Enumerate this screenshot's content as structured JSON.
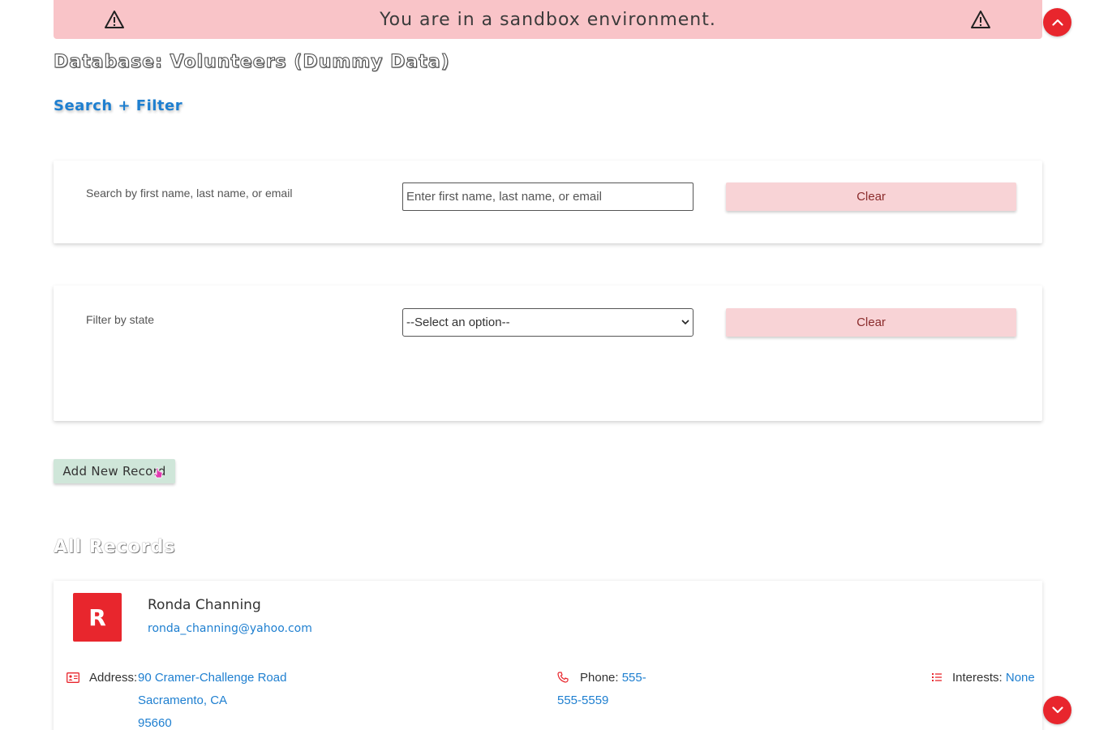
{
  "banner": {
    "text": "You are in a sandbox environment."
  },
  "header": {
    "title": "Database: Volunteers (Dummy Data)",
    "search_filter_link": "Search + Filter"
  },
  "search": {
    "label": "Search by first name, last name, or email",
    "placeholder": "Enter first name, last name, or email",
    "clear_label": "Clear"
  },
  "filter": {
    "label": "Filter by state",
    "selected": "--Select an option--",
    "clear_label": "Clear"
  },
  "actions": {
    "add_record": "Add New Record"
  },
  "records": {
    "title": "All Records",
    "items": [
      {
        "initial": "R",
        "name": "Ronda Channing",
        "email": "ronda_channing@yahoo.com",
        "address_label": "Address:",
        "address_line1": "90 Cramer-Challenge Road",
        "address_line2": "Sacramento, CA",
        "address_line3": "95660",
        "phone_label": "Phone:",
        "phone_part1": "555-",
        "phone_part2": "555-5559",
        "interests_label": "Interests:",
        "interests_value": "None"
      }
    ]
  },
  "colors": {
    "banner_bg": "#f9c4c8",
    "accent_red": "#e8262d",
    "link_blue": "#1e7fd0",
    "clear_bg": "#f8d3d6",
    "add_bg": "#cfe6d9"
  },
  "icons": {
    "banner_left": "warning-icon",
    "banner_right": "warning-icon",
    "scroll_up": "chevron-up-icon",
    "scroll_down": "chevron-down-icon",
    "address": "id-card-icon",
    "phone": "phone-icon",
    "interests": "list-icon"
  }
}
